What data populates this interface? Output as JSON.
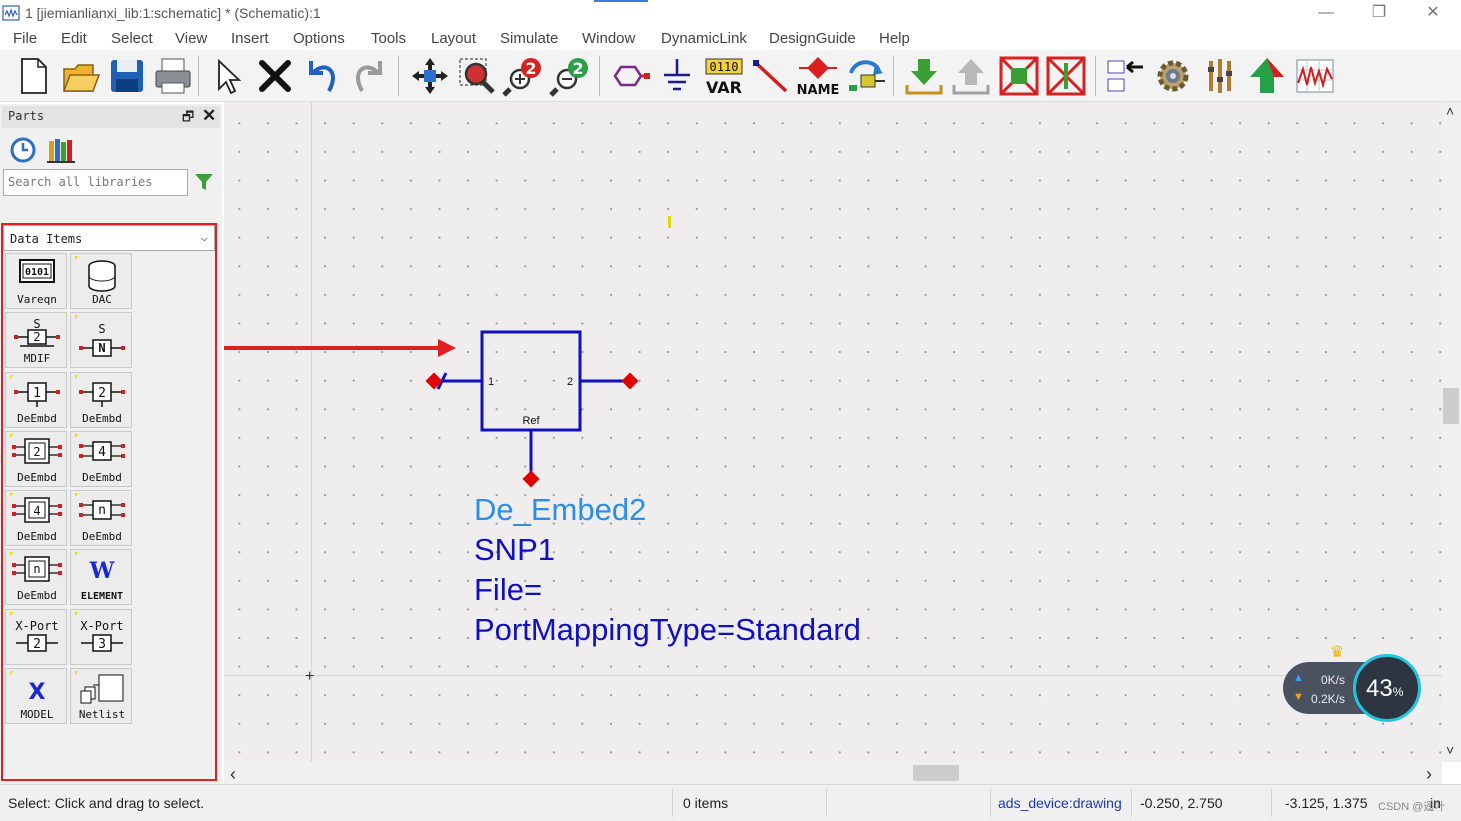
{
  "window": {
    "title": "1 [jiemianlianxi_lib:1:schematic] * (Schematic):1",
    "controls": {
      "minimize": "—",
      "restore": "❐",
      "close": "✕"
    }
  },
  "menu": [
    "File",
    "Edit",
    "Select",
    "View",
    "Insert",
    "Options",
    "Tools",
    "Layout",
    "Simulate",
    "Window",
    "DynamicLink",
    "DesignGuide",
    "Help"
  ],
  "toolbar": {
    "var_label": "VAR",
    "var_bits": "0110",
    "name_label": "NAME",
    "buttons": [
      "new-icon",
      "open-icon",
      "save-icon",
      "print-icon",
      "select-arrow-icon",
      "delete-icon",
      "undo-icon",
      "redo-icon",
      "move-icon",
      "zoom-area-icon",
      "zoom-in-icon",
      "zoom-out-icon",
      "port-icon",
      "ground-icon",
      "var-icon",
      "wire-icon",
      "name-icon",
      "update-icon",
      "push-down-icon",
      "pop-up-icon",
      "deactivate-icon",
      "short-icon",
      "symbol-icon",
      "simulate-gear-icon",
      "tuning-icon",
      "launch-icon",
      "data-display-icon"
    ]
  },
  "parts": {
    "title": "Parts",
    "float_glyph": "🗗",
    "close_glyph": "✕",
    "search_placeholder": "Search all libraries",
    "library": "Data Items",
    "items": [
      {
        "label": "Vareqn",
        "icon": "vareqn-icon"
      },
      {
        "label": "DAC",
        "icon": "dac-icon"
      },
      {
        "label": "MDIF",
        "icon": "s2-mdif-icon"
      },
      {
        "label": "",
        "icon": "snp-icon"
      },
      {
        "label": "DeEmbd",
        "icon": "deembed1-icon"
      },
      {
        "label": "DeEmbd",
        "icon": "deembed2-icon"
      },
      {
        "label": "DeEmbd",
        "icon": "deembed2-box-icon"
      },
      {
        "label": "DeEmbd",
        "icon": "deembed4-icon"
      },
      {
        "label": "DeEmbd",
        "icon": "deembed4-box-icon"
      },
      {
        "label": "DeEmbd",
        "icon": "deembedn-icon"
      },
      {
        "label": "DeEmbd",
        "icon": "deembedn-box-icon"
      },
      {
        "label": "ELEMENT",
        "icon": "w-element-icon"
      },
      {
        "label": "",
        "icon": "xport2-icon"
      },
      {
        "label": "",
        "icon": "xport3-icon"
      },
      {
        "label": "MODEL",
        "icon": "x-model-icon"
      },
      {
        "label": "Netlist",
        "icon": "netlist-icon"
      }
    ],
    "glyphs": {
      "vareqn": "0101",
      "s": "S",
      "two": "2",
      "n": "N",
      "one": "1",
      "four": "4",
      "nn": "n",
      "w": "W",
      "xport": "X-Port",
      "three": "3",
      "x": "X"
    }
  },
  "component": {
    "pin1": "1",
    "pin2": "2",
    "ref": "Ref",
    "lines": [
      "De_Embed2",
      "SNP1",
      "File=",
      "PortMappingType=Standard"
    ],
    "line_colors": [
      "#2b8ee8",
      "#1010c0",
      "#1010c0",
      "#1010c0"
    ]
  },
  "scroll": {
    "up": "˄",
    "down": "˅",
    "left": "‹",
    "right": "›"
  },
  "status": {
    "message": "Select: Click and drag to select.",
    "items": "0 items",
    "view": "ads_device:drawing",
    "coord1": "-0.250, 2.750",
    "coord2": "-3.125, 1.375",
    "unit": "in"
  },
  "network": {
    "up": "0K/s",
    "down": "0.2K/s",
    "percent": "43",
    "percent_unit": "%",
    "badge": "VIP"
  },
  "watermark": "CSDN @遥叶",
  "colors": {
    "accent": "#e02020",
    "schematic_blue": "#1010c0",
    "pin_red": "#e00000"
  }
}
